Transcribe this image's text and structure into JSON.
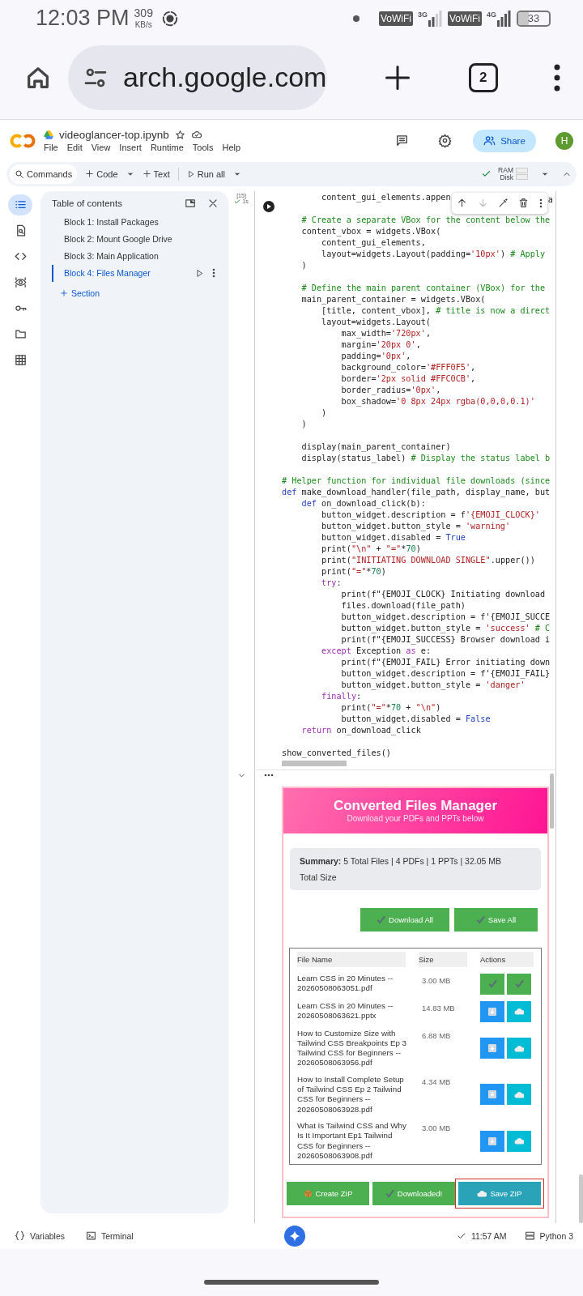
{
  "status_bar": {
    "time": "12:03 PM",
    "speed": "309",
    "speed_unit": "KB/s",
    "indicators": [
      {
        "kind": "badge",
        "text": "VoWiFi"
      },
      {
        "kind": "signal",
        "text": "3G",
        "level": 0.5
      },
      {
        "kind": "badge",
        "text": "VoWiFi"
      },
      {
        "kind": "signal",
        "text": "4G",
        "level": 1
      },
      {
        "kind": "battery",
        "text": "33",
        "level": 0.33
      }
    ]
  },
  "browser": {
    "url": "arch.google.com",
    "tab_count": "2"
  },
  "notebook": {
    "title": "videoglancer-top.ipynb",
    "menu": [
      "File",
      "Edit",
      "View",
      "Insert",
      "Runtime",
      "Tools",
      "Help"
    ],
    "share": "Share",
    "avatar": "H"
  },
  "toolbar": {
    "commands": "Commands",
    "code": "Code",
    "text": "Text",
    "run_all": "Run all",
    "ram": "RAM",
    "disk": "Disk",
    "connected": true
  },
  "rail": [
    {
      "kind": "toc",
      "selected": true
    },
    {
      "kind": "find",
      "selected": false
    },
    {
      "kind": "code",
      "selected": false
    },
    {
      "kind": "variables",
      "selected": false
    },
    {
      "kind": "secrets",
      "selected": false
    },
    {
      "kind": "files",
      "selected": false
    },
    {
      "kind": "table",
      "selected": false
    }
  ],
  "toc": {
    "title": "Table of contents",
    "items": [
      {
        "label": "Block 1: Install Packages",
        "selected": false
      },
      {
        "label": "Block 2: Mount Google Drive",
        "selected": false
      },
      {
        "label": "Block 3: Main Application",
        "selected": false
      },
      {
        "label": "Block 4: Files Manager",
        "selected": true
      }
    ],
    "add_section": "Section"
  },
  "code_cell": {
    "execution_count": "[15]",
    "duration": "1s",
    "lines": [
      {
        "text": "        content_gui_elements.appen",
        "tail": "a"
      },
      {
        "text": "    # Create a separate VBox for the content below the",
        "gap": true
      },
      {
        "text": "    content_vbox = widgets.VBox("
      },
      {
        "text": "        content_gui_elements,"
      },
      {
        "text": "        layout=widgets.Layout(padding='10px') # Apply"
      },
      {
        "text": "    )"
      },
      {
        "text": "    # Define the main parent container (VBox) for the",
        "gap": true
      },
      {
        "text": "    main_parent_container = widgets.VBox("
      },
      {
        "text": "        [title, content_vbox], # title is now a direct"
      },
      {
        "text": "        layout=widgets.Layout("
      },
      {
        "text": "            max_width='720px',"
      },
      {
        "text": "            margin='20px 0',"
      },
      {
        "text": "            padding='0px',"
      },
      {
        "text": "            background_color='#FFF0F5',"
      },
      {
        "text": "            border='2px solid #FFC0CB',"
      },
      {
        "text": "            border_radius='0px',"
      },
      {
        "text": "            box_shadow='0 8px 24px rgba(0,0,0,0.1)'"
      },
      {
        "text": "        )"
      },
      {
        "text": "    )"
      },
      {
        "text": "    display(main_parent_container)",
        "gap": true
      },
      {
        "text": "    display(status_label) # Display the status label b"
      },
      {
        "text": "# Helper function for individual file downloads (since",
        "gap": true
      },
      {
        "text": "def make_download_handler(file_path, display_name, but"
      },
      {
        "text": "    def on_download_click(b):"
      },
      {
        "text": "        button_widget.description = f'{EMOJI_CLOCK}'"
      },
      {
        "text": "        button_widget.button_style = 'warning'"
      },
      {
        "text": "        button_widget.disabled = True"
      },
      {
        "text": "        print(\"\\n\" + \"=\"*70)"
      },
      {
        "text": "        print(\"INITIATING DOWNLOAD SINGLE\".upper())"
      },
      {
        "text": "        print(\"=\"*70)"
      },
      {
        "text": "        try:"
      },
      {
        "text": "            print(f\"{EMOJI_CLOCK} Initiating download"
      },
      {
        "text": "            files.download(file_path)"
      },
      {
        "text": "            button_widget.description = f'{EMOJI_SUCCE"
      },
      {
        "text": "            button_widget.button_style = 'success' # C"
      },
      {
        "text": "            print(f\"{EMOJI_SUCCESS} Browser download i"
      },
      {
        "text": "        except Exception as e:"
      },
      {
        "text": "            print(f\"{EMOJI_FAIL} Error initiating down"
      },
      {
        "text": "            button_widget.description = f'{EMOJI_FAIL}"
      },
      {
        "text": "            button_widget.button_style = 'danger'"
      },
      {
        "text": "        finally:"
      },
      {
        "text": "            print(\"=\"*70 + \"\\n\")"
      },
      {
        "text": "            button_widget.disabled = False"
      },
      {
        "text": "    return on_download_click"
      },
      {
        "text": "show_converted_files()",
        "gap": true
      }
    ]
  },
  "output": {
    "title": "Converted Files Manager",
    "subtitle": "Download your PDFs and PPTs below",
    "summary": "**Summary:** 5 Total Files | 4 PDFs | 1 PPTs | 32.05 MB Total Size",
    "top_buttons": [
      "Download All",
      "Save All"
    ],
    "columns": [
      "File Name",
      "Size",
      "Actions"
    ],
    "files": [
      {
        "name": "Learn CSS in 20 Minutes -- 20260508063051.pdf",
        "size": "3.00 MB",
        "downloaded": true
      },
      {
        "name": "Learn CSS in 20 Minutes -- 20260508063621.pptx",
        "size": "14.83 MB",
        "downloaded": false
      },
      {
        "name": "How to Customize Size with Tailwind CSS Breakpoints Ep 3 Tailwind CSS for Beginners -- 20260508063956.pdf",
        "size": "6.88 MB",
        "downloaded": false
      },
      {
        "name": "How to Install Complete Setup of Tailwind CSS Ep 2 Tailwind CSS for Beginners -- 20260508063928.pdf",
        "size": "4.34 MB",
        "downloaded": false
      },
      {
        "name": "What Is Tailwind CSS and Why Is It Important Ep1 Tailwind CSS for Beginners -- 20260508063908.pdf",
        "size": "3.00 MB",
        "downloaded": false
      }
    ],
    "bottom_buttons": [
      {
        "label": "Create ZIP",
        "kind": "create",
        "focused": false
      },
      {
        "label": "Downloaded!",
        "kind": "done",
        "focused": false
      },
      {
        "label": "Save ZIP",
        "kind": "save",
        "focused": true
      }
    ]
  },
  "bottom_bar": {
    "variables": "Variables",
    "terminal": "Terminal",
    "status_time": "11:57 AM",
    "runtime": "Python 3"
  }
}
